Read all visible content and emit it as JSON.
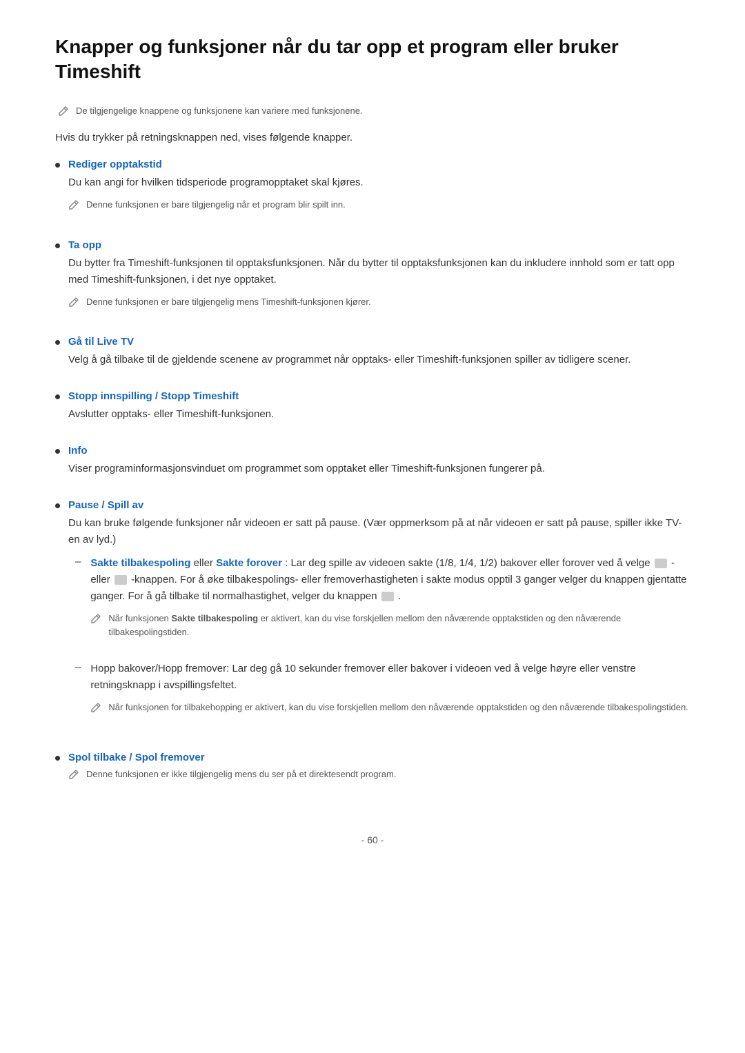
{
  "page": {
    "title": "Knapper og funksjoner når du tar opp et program eller bruker Timeshift",
    "intro_note": "De tilgjengelige knappene og funksjonene kan variere med funksjonene.",
    "intro_text": "Hvis du trykker på retningsknappen ned, vises følgende knapper.",
    "page_number": "- 60 -",
    "items": [
      {
        "id": "rediger",
        "title": "Rediger opptakstid",
        "body": "Du kan angi for hvilken tidsperiode programopptaket skal kjøres.",
        "note": "Denne funksjonen er bare tilgjengelig når et program blir spilt inn."
      },
      {
        "id": "ta-opp",
        "title": "Ta opp",
        "body": "Du bytter fra Timeshift-funksjonen til opptaksfunksjonen. Når du bytter til opptaksfunksjonen kan du inkludere innhold som er tatt opp med Timeshift-funksjonen, i det nye opptaket.",
        "note": "Denne funksjonen er bare tilgjengelig mens Timeshift-funksjonen kjører."
      },
      {
        "id": "ga-til-live",
        "title": "Gå til Live TV",
        "body": "Velg å gå tilbake til de gjeldende scenene av programmet når opptaks- eller Timeshift-funksjonen spiller av tidligere scener.",
        "note": null
      },
      {
        "id": "stopp",
        "title_part1": "Stopp innspilling",
        "title_sep": " / ",
        "title_part2": "Stopp Timeshift",
        "body": "Avslutter opptaks- eller Timeshift-funksjonen.",
        "note": null
      },
      {
        "id": "info",
        "title": "Info",
        "body": "Viser programinformasjonsvinduet om programmet som opptaket eller Timeshift-funksjonen fungerer på.",
        "note": null
      },
      {
        "id": "pause-spill",
        "title_part1": "Pause",
        "title_sep": " / ",
        "title_part2": "Spill av",
        "body": "Du kan bruke følgende funksjoner når videoen er satt på pause. (Vær oppmerksom på at når videoen er satt på pause, spiller ikke TV-en av lyd.)",
        "note": null,
        "subitems": [
          {
            "id": "sakte",
            "body_pre": "",
            "link1": "Sakte tilbakespoling",
            "body_mid": " eller ",
            "link2": "Sakte forover",
            "body_post": ": Lar deg spille av videoen sakte (1/8, 1/4, 1/2) bakover eller forover ved å velge",
            "body_post2": "- eller",
            "body_post3": "-knappen. For å øke tilbakespolings- eller fremoverhastigheten i sakte modus opptil 3 ganger velger du knappen gjentatte ganger. For å gå tilbake til normalhastighet, velger du knappen",
            "body_post4": ".",
            "note": "Når funksjonen Sakte tilbakespoling er aktivert, kan du vise forskjellen mellom den nåværende opptakstiden og den nåværende tilbakespolingstiden.",
            "note_link": "Sakte tilbakespoling"
          },
          {
            "id": "hopp",
            "body": "Hopp bakover/Hopp fremover: Lar deg gå 10 sekunder fremover eller bakover i videoen ved å velge høyre eller venstre retningsknapp i avspillingsfeltet.",
            "note": "Når funksjonen for tilbakehopping er aktivert, kan du vise forskjellen mellom den nåværende opptakstiden og den nåværende tilbakespolingstiden."
          }
        ]
      },
      {
        "id": "spol",
        "title_part1": "Spol tilbake",
        "title_sep": " / ",
        "title_part2": "Spol fremover",
        "body": null,
        "note": "Denne funksjonen er ikke tilgjengelig mens du ser på et direktesendt program."
      }
    ]
  }
}
